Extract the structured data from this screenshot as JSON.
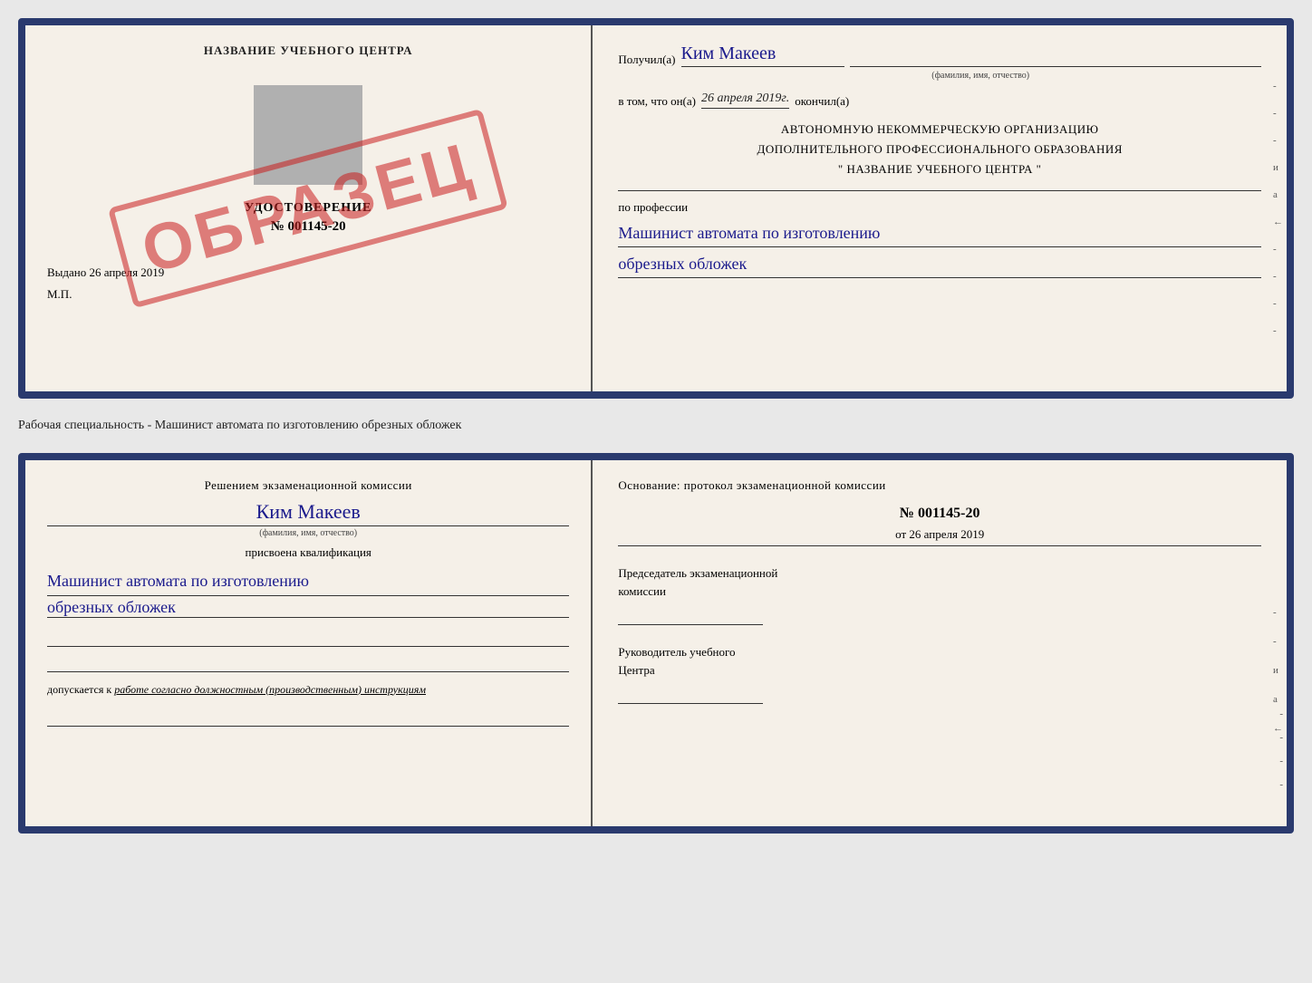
{
  "topCert": {
    "left": {
      "schoolNameHeader": "НАЗВАНИЕ УЧЕБНОГО ЦЕНТРА",
      "stampText": "ОБРАЗЕЦ",
      "udostoverenie": {
        "title": "УДОСТОВЕРЕНИЕ",
        "number": "№ 001145-20"
      },
      "vydano": "Выдано",
      "vydanoDate": "26 апреля 2019",
      "mp": "М.П."
    },
    "right": {
      "poluchilLabel": "Получил(а)",
      "recipientName": "Ким Макеев",
      "fioSubtitle": "(фамилия, имя, отчество)",
      "vtomLabel": "в том, что он(а)",
      "date": "26 апреля 2019г.",
      "okonchilLabel": "окончил(а)",
      "orgLines": [
        "АВТОНОМНУЮ НЕКОММЕРЧЕСКУЮ ОРГАНИЗАЦИЮ",
        "ДОПОЛНИТЕЛЬНОГО ПРОФЕССИОНАЛЬНОГО ОБРАЗОВАНИЯ",
        "\"   НАЗВАНИЕ УЧЕБНОГО ЦЕНТРА   \""
      ],
      "poProfessiiLabel": "по профессии",
      "profession1": "Машинист автомата по изготовлению",
      "profession2": "обрезных обложек",
      "sideMarks": [
        "-",
        "-",
        "-",
        "и",
        "а",
        "←",
        "-",
        "-",
        "-",
        "-"
      ]
    }
  },
  "specialtySubtitle": "Рабочая специальность - Машинист автомата по изготовлению обрезных обложек",
  "bottomCert": {
    "left": {
      "resheniemText": "Решением экзаменационной комиссии",
      "recipientName": "Ким Макеев",
      "fioSubtitle": "(фамилия, имя, отчество)",
      "prisvoenaText": "присвоена квалификация",
      "qual1": "Машинист автомата по изготовлению",
      "qual2": "обрезных обложек",
      "dopuskaetsyaText": "допускается к",
      "dopuskaetsyaRest": "работе согласно должностным (производственным) инструкциям"
    },
    "right": {
      "osnovanieLabelLine1": "Основание: протокол экзаменационной комиссии",
      "protocolNum": "№ 001145-20",
      "otLabel": "от",
      "otDate": "26 апреля 2019",
      "predsedatelLabel1": "Председатель экзаменационной",
      "predsedatelLabel2": "комиссии",
      "rukovoditelLabel1": "Руководитель учебного",
      "rukovoditelLabel2": "Центра",
      "sideMarks": [
        "-",
        "-",
        "-",
        "и",
        "а",
        "←",
        "-",
        "-",
        "-",
        "-"
      ]
    }
  }
}
